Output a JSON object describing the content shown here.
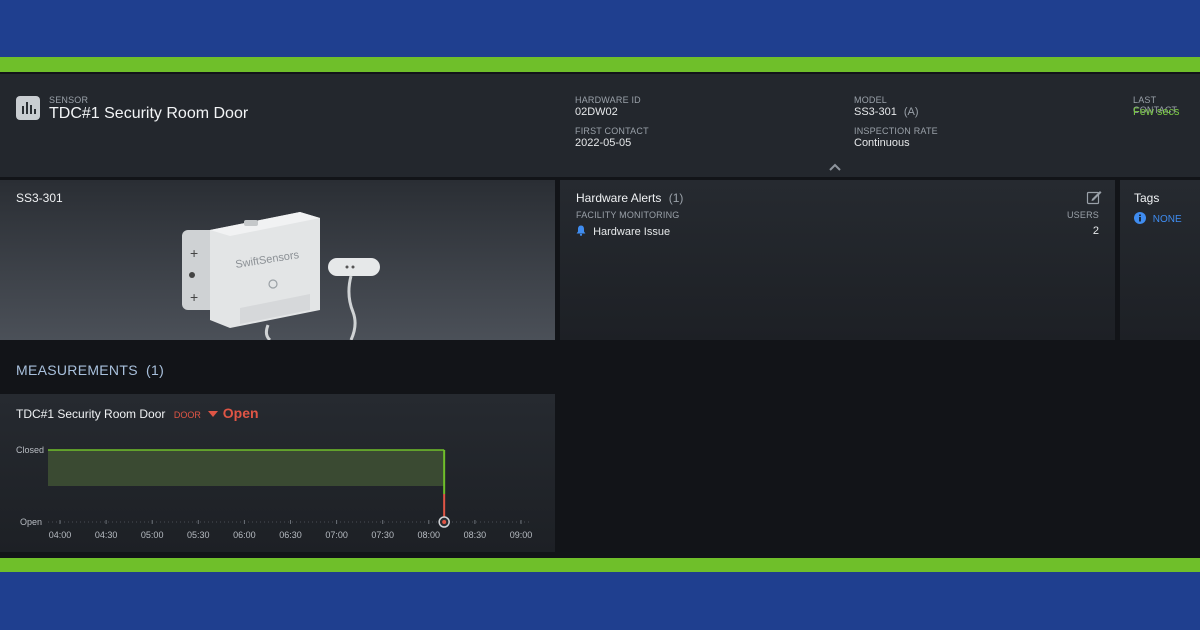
{
  "header": {
    "sensor_label": "SENSOR",
    "sensor_name": "TDC#1 Security Room Door",
    "hardware_id_label": "HARDWARE ID",
    "hardware_id": "02DW02",
    "first_contact_label": "FIRST CONTACT",
    "first_contact": "2022-05-05",
    "model_label": "MODEL",
    "model": "SS3-301",
    "model_suffix": "(A)",
    "inspection_rate_label": "INSPECTION RATE",
    "inspection_rate": "Continuous",
    "last_contact_label": "LAST CONTACT",
    "last_contact": "Few secs"
  },
  "device_panel": {
    "title": "SS3-301",
    "brand": "SwiftSensors"
  },
  "alerts": {
    "title": "Hardware Alerts",
    "count": "(1)",
    "section_label": "FACILITY MONITORING",
    "users_label": "USERS",
    "item_label": "Hardware Issue",
    "item_users": "2"
  },
  "tags": {
    "title": "Tags",
    "none_label": "NONE"
  },
  "measurements": {
    "title": "MEASUREMENTS",
    "count": "(1)"
  },
  "chart": {
    "name": "TDC#1 Security Room Door",
    "type_label": "DOOR",
    "state": "Open"
  },
  "chart_data": {
    "type": "line",
    "title": "TDC#1 Security Room Door",
    "y_categories": [
      "Open",
      "Closed"
    ],
    "x_ticks": [
      "04:00",
      "04:30",
      "05:00",
      "05:30",
      "06:00",
      "06:30",
      "07:00",
      "07:30",
      "08:00",
      "08:30",
      "09:00"
    ],
    "xlim": [
      "04:00",
      "09:00"
    ],
    "segments": [
      {
        "from": "04:00",
        "to": "08:10",
        "state": "Closed"
      },
      {
        "from": "08:10",
        "to": "09:00",
        "state": "Open"
      }
    ],
    "transition": {
      "time": "08:10",
      "to_state": "Open"
    },
    "colors": {
      "closed": "#6fbf2a",
      "open": "#e05545"
    }
  },
  "colors": {
    "accent_blue": "#3f8cf0",
    "ok_green": "#7ac943",
    "alert_red": "#e05545"
  }
}
